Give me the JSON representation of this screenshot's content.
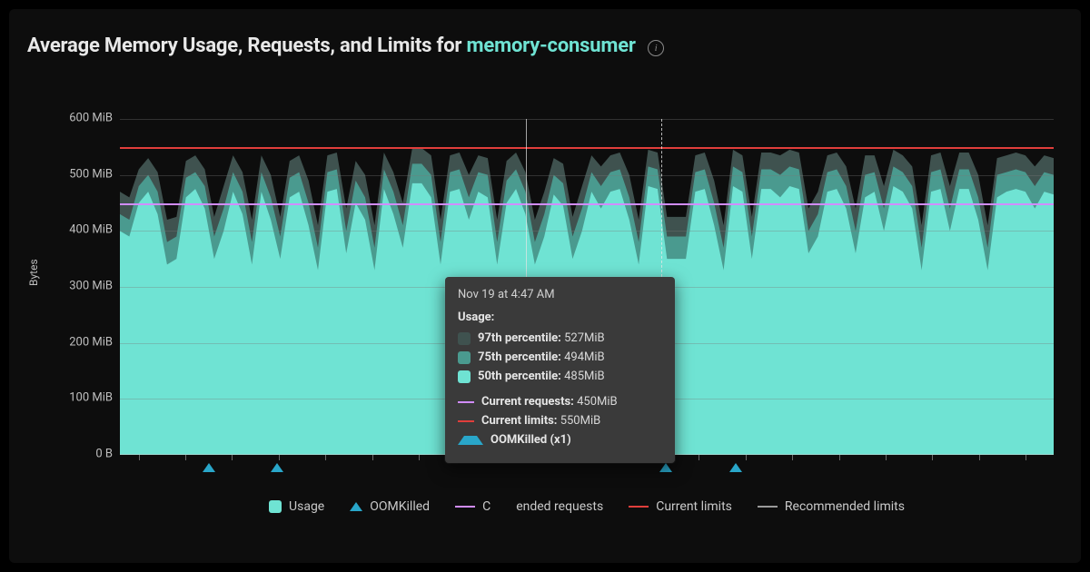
{
  "title": {
    "prefix": "Average Memory Usage, Requests, and Limits for ",
    "subject": "memory-consumer"
  },
  "ylabel": "Bytes",
  "y_ticks": [
    {
      "v": 0,
      "label": "0 B"
    },
    {
      "v": 100,
      "label": "100 MiB"
    },
    {
      "v": 200,
      "label": "200 MiB"
    },
    {
      "v": 300,
      "label": "300 MiB"
    },
    {
      "v": 400,
      "label": "400 MiB"
    },
    {
      "v": 500,
      "label": "500 MiB"
    },
    {
      "v": 600,
      "label": "600 MiB"
    }
  ],
  "colors": {
    "p50": "#6fe3d3",
    "p75": "#4a9a8f",
    "p97": "#3f524f",
    "requests": "#d18cff",
    "limits": "#e03e3b",
    "recommended": "#9a9a9a",
    "oom": "#29a6c9"
  },
  "legend": {
    "usage": "Usage",
    "oom": "OOMKilled",
    "requests_short": "C",
    "recommended_requests": "ended requests",
    "limits": "Current limits",
    "recommended_limits": "Recommended limits"
  },
  "tooltip": {
    "time": "Nov 19 at 4:47 AM",
    "section": "Usage:",
    "rows": [
      {
        "kind": "sq",
        "color": "#3f524f",
        "label": "97th percentile:",
        "value": "527MiB"
      },
      {
        "kind": "sq",
        "color": "#4a9a8f",
        "label": "75th percentile:",
        "value": "494MiB"
      },
      {
        "kind": "sq",
        "color": "#6fe3d3",
        "label": "50th percentile:",
        "value": "485MiB"
      }
    ],
    "req": {
      "label": "Current requests:",
      "value": "450MiB"
    },
    "lim": {
      "label": "Current limits:",
      "value": "550MiB"
    },
    "oom": {
      "label": "OOMKilled (x1)"
    }
  },
  "chart_data": {
    "type": "area",
    "ylabel": "Bytes",
    "ylim": [
      0,
      600
    ],
    "unit": "MiB",
    "requests": 450,
    "limits": 550,
    "cursor_solid_x": 0.435,
    "cursor_dashed_x": 0.58,
    "oom_markers_x": [
      0.095,
      0.168,
      0.585,
      0.66
    ],
    "x_tick_marks": [
      0.02,
      0.07,
      0.12,
      0.17,
      0.22,
      0.27,
      0.32,
      0.37,
      0.42,
      0.47,
      0.52,
      0.57,
      0.62,
      0.67,
      0.72,
      0.77,
      0.82,
      0.87,
      0.92,
      0.97
    ],
    "series": [
      {
        "name": "50th percentile",
        "color": "#6fe3d3",
        "values": [
          400,
          390,
          450,
          470,
          430,
          340,
          350,
          460,
          475,
          440,
          350,
          400,
          470,
          430,
          340,
          470,
          420,
          350,
          460,
          470,
          410,
          330,
          470,
          475,
          360,
          450,
          420,
          330,
          475,
          430,
          370,
          485,
          485,
          460,
          340,
          470,
          475,
          420,
          470,
          460,
          340,
          450,
          475,
          430,
          340,
          390,
          465,
          445,
          350,
          400,
          470,
          440,
          470,
          475,
          420,
          340,
          480,
          475,
          350,
          350,
          350,
          470,
          475,
          410,
          330,
          480,
          470,
          350,
          475,
          475,
          460,
          480,
          475,
          360,
          390,
          470,
          475,
          440,
          360,
          460,
          470,
          400,
          480,
          470,
          440,
          330,
          470,
          475,
          400,
          475,
          475,
          420,
          330,
          460,
          470,
          475,
          470,
          440,
          470,
          465
        ]
      },
      {
        "name": "75th percentile",
        "color": "#4a9a8f",
        "values": [
          430,
          420,
          480,
          500,
          470,
          380,
          390,
          495,
          505,
          480,
          390,
          440,
          505,
          470,
          380,
          505,
          460,
          390,
          495,
          505,
          450,
          370,
          505,
          510,
          400,
          490,
          460,
          370,
          510,
          470,
          410,
          520,
          520,
          500,
          380,
          505,
          510,
          460,
          505,
          500,
          380,
          490,
          510,
          470,
          380,
          430,
          500,
          485,
          390,
          440,
          505,
          480,
          505,
          510,
          460,
          380,
          515,
          510,
          390,
          390,
          390,
          505,
          510,
          450,
          370,
          515,
          505,
          390,
          510,
          510,
          500,
          515,
          510,
          400,
          430,
          505,
          510,
          480,
          400,
          500,
          505,
          440,
          515,
          505,
          480,
          370,
          505,
          510,
          440,
          510,
          510,
          460,
          370,
          500,
          505,
          510,
          505,
          480,
          505,
          500
        ]
      },
      {
        "name": "97th percentile",
        "color": "#3f524f",
        "values": [
          470,
          460,
          510,
          530,
          505,
          420,
          425,
          525,
          535,
          510,
          425,
          480,
          535,
          505,
          420,
          535,
          500,
          425,
          525,
          535,
          490,
          410,
          535,
          540,
          440,
          525,
          500,
          410,
          540,
          505,
          450,
          548,
          548,
          535,
          420,
          535,
          540,
          500,
          535,
          530,
          420,
          525,
          540,
          505,
          420,
          470,
          530,
          520,
          425,
          480,
          535,
          515,
          535,
          540,
          500,
          420,
          545,
          540,
          425,
          425,
          425,
          535,
          540,
          490,
          410,
          545,
          535,
          425,
          540,
          540,
          535,
          545,
          540,
          440,
          470,
          535,
          540,
          515,
          440,
          535,
          535,
          480,
          545,
          535,
          515,
          410,
          535,
          540,
          480,
          540,
          540,
          500,
          410,
          530,
          535,
          540,
          535,
          515,
          535,
          530
        ]
      }
    ]
  }
}
